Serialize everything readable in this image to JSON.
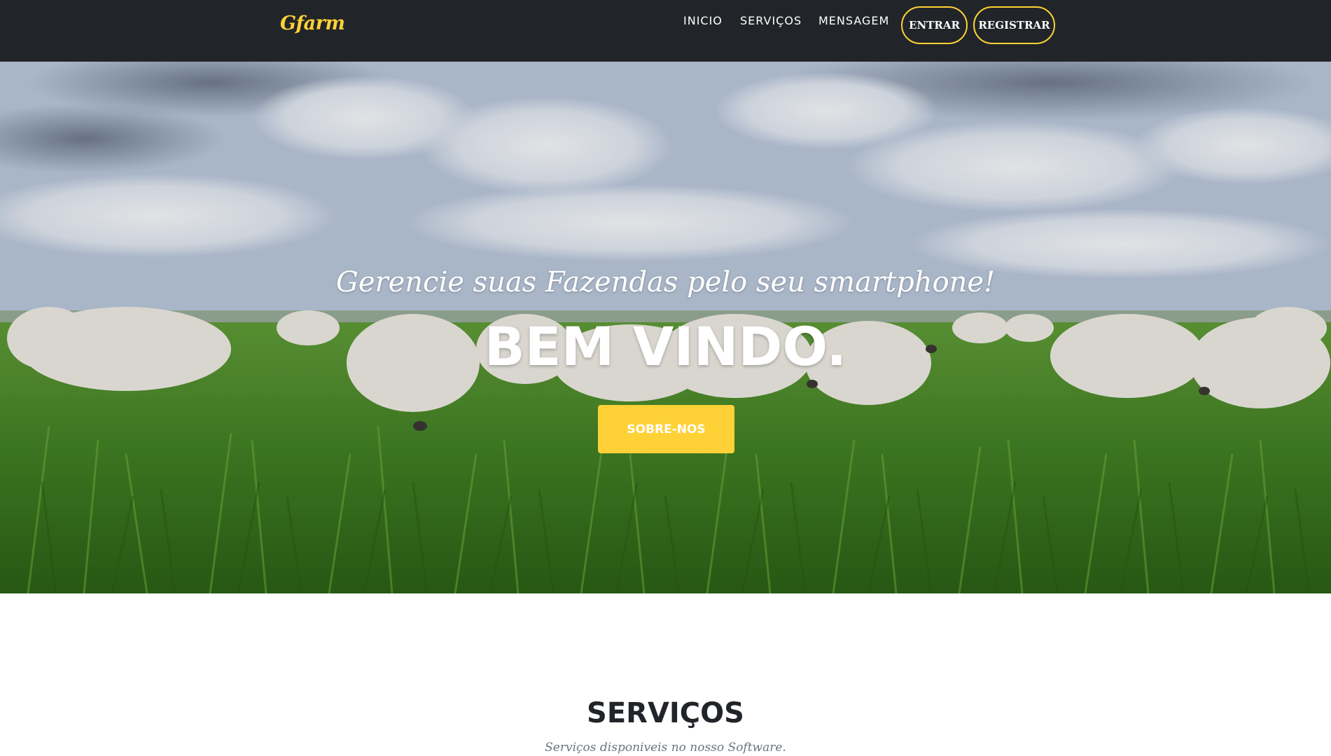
{
  "nav": {
    "brand": "Gfarm",
    "links": [
      "INICIO",
      "SERVIÇOS",
      "MENSAGEM"
    ],
    "login_label": "ENTRAR",
    "register_label": "REGISTRAR"
  },
  "hero": {
    "subtitle": "Gerencie suas Fazendas pelo seu smartphone!",
    "title": "BEM VINDO.",
    "button_label": "SOBRE-NOS",
    "background_image": "pasture-with-white-cattle"
  },
  "services": {
    "title": "SERVIÇOS",
    "subtitle": "Serviços disponiveis no nosso Software."
  },
  "colors": {
    "accent": "#fed136",
    "navbar": "#212529",
    "text_dark": "#212529",
    "text_muted": "#6c757d"
  }
}
